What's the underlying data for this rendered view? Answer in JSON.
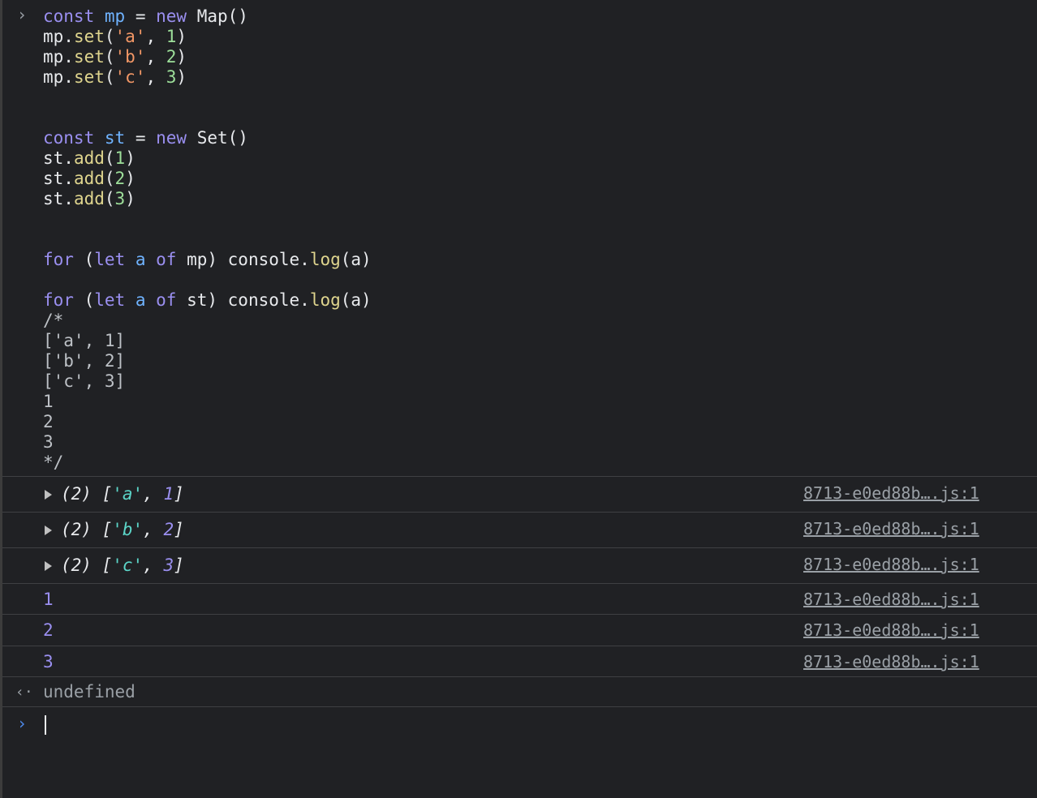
{
  "prompt_glyph": "›",
  "code_lines": [
    [
      {
        "t": "const",
        "c": "kw2"
      },
      {
        "t": " "
      },
      {
        "t": "mp",
        "c": "var"
      },
      {
        "t": " = "
      },
      {
        "t": "new",
        "c": "kw2"
      },
      {
        "t": " Map()"
      }
    ],
    [
      {
        "t": "mp."
      },
      {
        "t": "set",
        "c": "fn"
      },
      {
        "t": "("
      },
      {
        "t": "'a'",
        "c": "str"
      },
      {
        "t": ", "
      },
      {
        "t": "1",
        "c": "num"
      },
      {
        "t": ")"
      }
    ],
    [
      {
        "t": "mp."
      },
      {
        "t": "set",
        "c": "fn"
      },
      {
        "t": "("
      },
      {
        "t": "'b'",
        "c": "str"
      },
      {
        "t": ", "
      },
      {
        "t": "2",
        "c": "num"
      },
      {
        "t": ")"
      }
    ],
    [
      {
        "t": "mp."
      },
      {
        "t": "set",
        "c": "fn"
      },
      {
        "t": "("
      },
      {
        "t": "'c'",
        "c": "str"
      },
      {
        "t": ", "
      },
      {
        "t": "3",
        "c": "num"
      },
      {
        "t": ")"
      }
    ],
    [],
    [],
    [
      {
        "t": "const",
        "c": "kw2"
      },
      {
        "t": " "
      },
      {
        "t": "st",
        "c": "var"
      },
      {
        "t": " = "
      },
      {
        "t": "new",
        "c": "kw2"
      },
      {
        "t": " Set()"
      }
    ],
    [
      {
        "t": "st."
      },
      {
        "t": "add",
        "c": "fn"
      },
      {
        "t": "("
      },
      {
        "t": "1",
        "c": "num"
      },
      {
        "t": ")"
      }
    ],
    [
      {
        "t": "st."
      },
      {
        "t": "add",
        "c": "fn"
      },
      {
        "t": "("
      },
      {
        "t": "2",
        "c": "num"
      },
      {
        "t": ")"
      }
    ],
    [
      {
        "t": "st."
      },
      {
        "t": "add",
        "c": "fn"
      },
      {
        "t": "("
      },
      {
        "t": "3",
        "c": "num"
      },
      {
        "t": ")"
      }
    ],
    [],
    [],
    [
      {
        "t": "for",
        "c": "kw2"
      },
      {
        "t": " ("
      },
      {
        "t": "let",
        "c": "kw2"
      },
      {
        "t": " "
      },
      {
        "t": "a",
        "c": "var"
      },
      {
        "t": " "
      },
      {
        "t": "of",
        "c": "kw2"
      },
      {
        "t": " mp) console."
      },
      {
        "t": "log",
        "c": "fn"
      },
      {
        "t": "(a)"
      }
    ],
    [],
    [
      {
        "t": "for",
        "c": "kw2"
      },
      {
        "t": " ("
      },
      {
        "t": "let",
        "c": "kw2"
      },
      {
        "t": " "
      },
      {
        "t": "a",
        "c": "var"
      },
      {
        "t": " "
      },
      {
        "t": "of",
        "c": "kw2"
      },
      {
        "t": " st) console."
      },
      {
        "t": "log",
        "c": "fn"
      },
      {
        "t": "(a)"
      }
    ],
    [
      {
        "t": "/*",
        "c": "cmt"
      }
    ],
    [
      {
        "t": "['a', 1]",
        "c": "cmt"
      }
    ],
    [
      {
        "t": "['b', 2]",
        "c": "cmt"
      }
    ],
    [
      {
        "t": "['c', 3]",
        "c": "cmt"
      }
    ],
    [
      {
        "t": "1",
        "c": "cmt"
      }
    ],
    [
      {
        "t": "2",
        "c": "cmt"
      }
    ],
    [
      {
        "t": "3",
        "c": "cmt"
      }
    ],
    [
      {
        "t": "*/",
        "c": "cmt"
      }
    ]
  ],
  "array_logs": [
    {
      "count": "(2)",
      "key": "'a'",
      "value": "1",
      "source": "8713-e0ed88b….js:1"
    },
    {
      "count": "(2)",
      "key": "'b'",
      "value": "2",
      "source": "8713-e0ed88b….js:1"
    },
    {
      "count": "(2)",
      "key": "'c'",
      "value": "3",
      "source": "8713-e0ed88b….js:1"
    }
  ],
  "number_logs": [
    {
      "value": "1",
      "source": "8713-e0ed88b….js:1"
    },
    {
      "value": "2",
      "source": "8713-e0ed88b….js:1"
    },
    {
      "value": "3",
      "source": "8713-e0ed88b….js:1"
    }
  ],
  "result": {
    "glyph": "‹·",
    "text": "undefined"
  },
  "input_prompt_glyph": "›"
}
